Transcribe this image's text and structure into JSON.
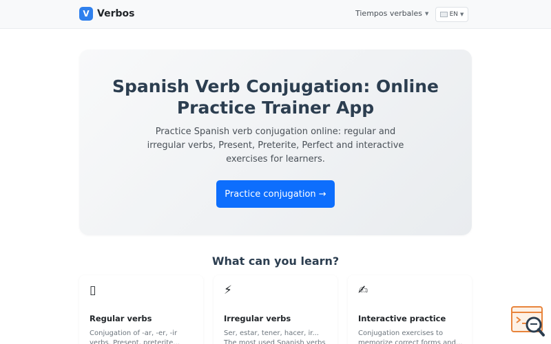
{
  "navbar": {
    "brand_letter": "V",
    "brand_name": "Verbos",
    "menu_label": "Tiempos verbales",
    "lang_label": "EN"
  },
  "hero": {
    "title": "Spanish Verb Conjugation: Online Practice Trainer App",
    "lead": "Practice Spanish verb conjugation online: regular and irregular verbs, Present, Preterite, Perfect and interactive exercises for learners.",
    "cta": "Practice conjugation →"
  },
  "features": {
    "heading": "What can you learn?",
    "cards": [
      {
        "icon": "book-icon",
        "glyph": "▯",
        "title": "Regular verbs",
        "text": "Conjugation of -ar, -er, -ir verbs. Present, preterite..."
      },
      {
        "icon": "lightning-icon",
        "glyph": "⚡",
        "title": "Irregular verbs",
        "text": "Ser, estar, tener, hacer, ir... The most used Spanish verbs"
      },
      {
        "icon": "writing-hand-icon",
        "glyph": "✍",
        "title": "Interactive practice",
        "text": "Conjugation exercises to memorize correct forms and..."
      }
    ]
  },
  "colors": {
    "brand": "#2f80ed",
    "cta": "#0d6efd",
    "heading": "#2c3e50"
  }
}
